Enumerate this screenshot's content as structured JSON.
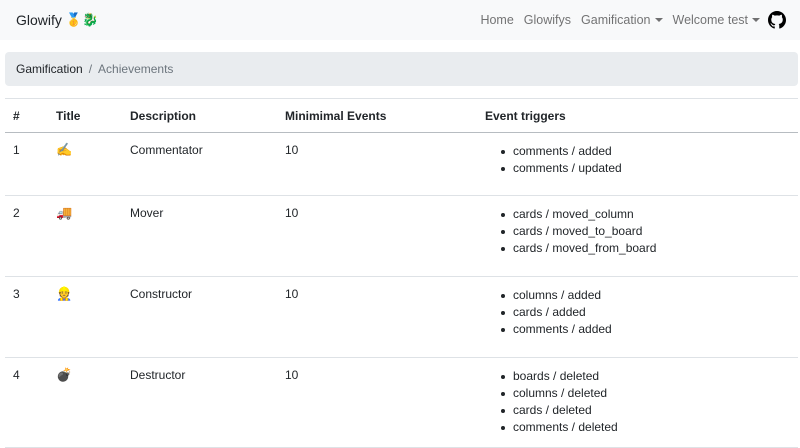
{
  "navbar": {
    "brand": "Glowify",
    "brand_emoji": "🥇🐉",
    "links": {
      "home": "Home",
      "glowifys": "Glowifys",
      "gamification": "Gamification",
      "welcome": "Welcome test"
    },
    "github_icon": "github-icon"
  },
  "breadcrumb": {
    "parent": "Gamification",
    "separator": "/",
    "current": "Achievements"
  },
  "table": {
    "headers": {
      "num": "#",
      "title": "Title",
      "description": "Description",
      "min_events": "Minimimal Events",
      "triggers": "Event triggers"
    },
    "rows": [
      {
        "num": "1",
        "icon": "✍️",
        "description": "Commentator",
        "min_events": "10",
        "triggers": [
          "comments / added",
          "comments / updated"
        ]
      },
      {
        "num": "2",
        "icon": "🚚",
        "description": "Mover",
        "min_events": "10",
        "triggers": [
          "cards / moved_column",
          "cards / moved_to_board",
          "cards / moved_from_board"
        ]
      },
      {
        "num": "3",
        "icon": "👷",
        "description": "Constructor",
        "min_events": "10",
        "triggers": [
          "columns / added",
          "cards / added",
          "comments / added"
        ]
      },
      {
        "num": "4",
        "icon": "💣",
        "description": "Destructor",
        "min_events": "10",
        "triggers": [
          "boards / deleted",
          "columns / deleted",
          "cards / deleted",
          "comments / deleted"
        ]
      }
    ]
  }
}
